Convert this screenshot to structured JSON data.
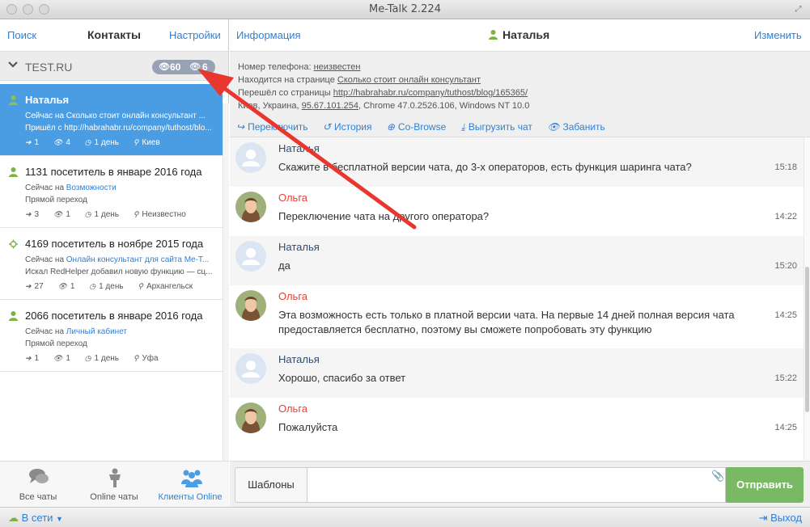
{
  "window": {
    "title": "Me-Talk 2.224"
  },
  "left_header": {
    "search": "Поиск",
    "title": "Контакты",
    "settings": "Настройки"
  },
  "group": {
    "name": "TEST.RU",
    "views": "60",
    "visitors": "6"
  },
  "contacts": [
    {
      "name": "Наталья",
      "line1": "Сейчас на Сколько стоит онлайн консультант ...",
      "line2": "Пришёл с http://habrahabr.ru/company/tuthost/blo...",
      "s1": "1",
      "s2": "4",
      "s3": "1 день",
      "s4": "Киев"
    },
    {
      "name": "1131 посетитель в январе 2016 года",
      "line1_pre": "Сейчас на ",
      "line1_link": "Возможности",
      "line2": "Прямой переход",
      "s1": "3",
      "s2": "1",
      "s3": "1 день",
      "s4": "Неизвестно"
    },
    {
      "name": "4169 посетитель в ноябре 2015 года",
      "line1_pre": "Сейчас на ",
      "line1_link": "Онлайн консультант для сайта Me-T...",
      "line2": "Искал RedHelper добавил новую функцию — сц...",
      "s1": "27",
      "s2": "1",
      "s3": "1 день",
      "s4": "Архангельск"
    },
    {
      "name": "2066 посетитель в январе 2016 года",
      "line1_pre": "Сейчас на ",
      "line1_link": "Личный кабинет",
      "line2": "Прямой переход",
      "s1": "1",
      "s2": "1",
      "s3": "1 день",
      "s4": "Уфа"
    }
  ],
  "bottom_nav": {
    "all": "Все чаты",
    "online": "Online чаты",
    "clients": "Клиенты Online"
  },
  "right_header": {
    "info": "Информация",
    "contact": "Наталья",
    "edit": "Изменить"
  },
  "info": {
    "phone_label": "Номер телефона: ",
    "phone_value": "неизвестен",
    "page_label": "Находится на странице ",
    "page_value": "Сколько стоит онлайн консультант",
    "from_label": "Перешёл со страницы ",
    "from_value": "http://habrahabr.ru/company/tuthost/blog/165365/",
    "geo": "Киев, Украина, ",
    "ip": "95.67.101.254",
    "browser": ", Chrome 47.0.2526.106, Windows NT 10.0"
  },
  "actions": {
    "transfer": "Переключить",
    "history": "История",
    "cobrowse": "Co-Browse",
    "export": "Выгрузить чат",
    "ban": "Забанить"
  },
  "messages": [
    {
      "who": "Наталья",
      "text": "Скажите в бесплатной версии чата, до 3-х операторов, есть функция шаринга чата?",
      "time": "15:18"
    },
    {
      "who": "Ольга",
      "text": "Переключение чата на другого оператора?",
      "time": "14:22"
    },
    {
      "who": "Наталья",
      "text": "да",
      "time": "15:20"
    },
    {
      "who": "Ольга",
      "text": "Эта возможность есть только в платной версии чата. На первые 14 дней полная версия чата предоставляется бесплатно, поэтому вы сможете попробовать эту функцию",
      "time": "14:25"
    },
    {
      "who": "Наталья",
      "text": "Хорошо, спасибо за ответ",
      "time": "15:22"
    },
    {
      "who": "Ольга",
      "text": "Пожалуйста",
      "time": "14:25"
    }
  ],
  "composer": {
    "templates": "Шаблоны",
    "send": "Отправить"
  },
  "status": {
    "online": "В сети",
    "logout": "Выход"
  },
  "colors": {
    "accent": "#2f7fd6",
    "active": "#4a9de3",
    "send": "#79b964",
    "operator": "#e0443c",
    "arrow": "#e8372f"
  }
}
